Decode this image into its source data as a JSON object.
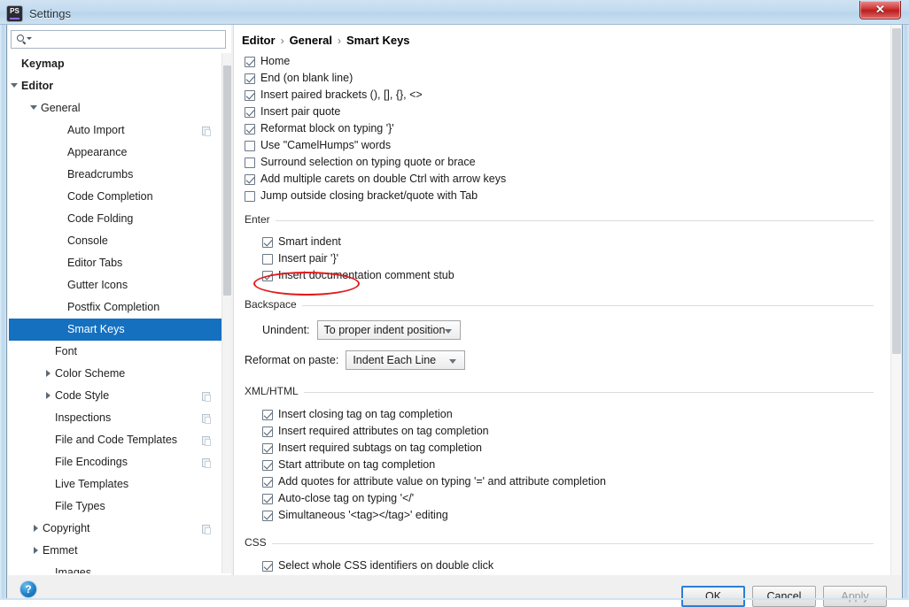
{
  "window": {
    "title": "Settings",
    "app_icon": "phpstorm-icon",
    "close_label": "✕",
    "ghost_text": "......... .... . ...... ...... .. ."
  },
  "search": {
    "value": "",
    "placeholder": "",
    "icon": "search-icon"
  },
  "sidebar": {
    "items": [
      {
        "label": "Keymap",
        "indent": 14,
        "bold": true,
        "arrow": "none",
        "copy": false,
        "selected": false
      },
      {
        "label": "Editor",
        "indent": 14,
        "bold": true,
        "arrow": "expanded",
        "copy": false,
        "selected": false
      },
      {
        "label": "General",
        "indent": 36,
        "bold": false,
        "arrow": "expanded",
        "copy": false,
        "selected": false
      },
      {
        "label": "Auto Import",
        "indent": 66,
        "bold": false,
        "arrow": "none",
        "copy": true,
        "selected": false
      },
      {
        "label": "Appearance",
        "indent": 66,
        "bold": false,
        "arrow": "none",
        "copy": false,
        "selected": false
      },
      {
        "label": "Breadcrumbs",
        "indent": 66,
        "bold": false,
        "arrow": "none",
        "copy": false,
        "selected": false
      },
      {
        "label": "Code Completion",
        "indent": 66,
        "bold": false,
        "arrow": "none",
        "copy": false,
        "selected": false
      },
      {
        "label": "Code Folding",
        "indent": 66,
        "bold": false,
        "arrow": "none",
        "copy": false,
        "selected": false
      },
      {
        "label": "Console",
        "indent": 66,
        "bold": false,
        "arrow": "none",
        "copy": false,
        "selected": false
      },
      {
        "label": "Editor Tabs",
        "indent": 66,
        "bold": false,
        "arrow": "none",
        "copy": false,
        "selected": false
      },
      {
        "label": "Gutter Icons",
        "indent": 66,
        "bold": false,
        "arrow": "none",
        "copy": false,
        "selected": false
      },
      {
        "label": "Postfix Completion",
        "indent": 66,
        "bold": false,
        "arrow": "none",
        "copy": false,
        "selected": false
      },
      {
        "label": "Smart Keys",
        "indent": 66,
        "bold": false,
        "arrow": "none",
        "copy": false,
        "selected": true
      },
      {
        "label": "Font",
        "indent": 52,
        "bold": false,
        "arrow": "none",
        "copy": false,
        "selected": false
      },
      {
        "label": "Color Scheme",
        "indent": 52,
        "bold": false,
        "arrow": "collapsed",
        "copy": false,
        "selected": false
      },
      {
        "label": "Code Style",
        "indent": 52,
        "bold": false,
        "arrow": "collapsed",
        "copy": true,
        "selected": false
      },
      {
        "label": "Inspections",
        "indent": 52,
        "bold": false,
        "arrow": "none",
        "copy": true,
        "selected": false
      },
      {
        "label": "File and Code Templates",
        "indent": 52,
        "bold": false,
        "arrow": "none",
        "copy": true,
        "selected": false
      },
      {
        "label": "File Encodings",
        "indent": 52,
        "bold": false,
        "arrow": "none",
        "copy": true,
        "selected": false
      },
      {
        "label": "Live Templates",
        "indent": 52,
        "bold": false,
        "arrow": "none",
        "copy": false,
        "selected": false
      },
      {
        "label": "File Types",
        "indent": 52,
        "bold": false,
        "arrow": "none",
        "copy": false,
        "selected": false
      },
      {
        "label": "Copyright",
        "indent": 38,
        "bold": false,
        "arrow": "collapsed",
        "copy": true,
        "selected": false
      },
      {
        "label": "Emmet",
        "indent": 38,
        "bold": false,
        "arrow": "collapsed",
        "copy": false,
        "selected": false
      },
      {
        "label": "Images",
        "indent": 52,
        "bold": false,
        "arrow": "none",
        "copy": false,
        "selected": false
      }
    ]
  },
  "breadcrumb": {
    "parts": [
      "Editor",
      "General",
      "Smart Keys"
    ],
    "separator": "›"
  },
  "main": {
    "top_options": [
      {
        "label": "Home",
        "checked": true
      },
      {
        "label": "End (on blank line)",
        "checked": true
      },
      {
        "label": "Insert paired brackets (), [], {}, <>",
        "checked": true
      },
      {
        "label": "Insert pair quote",
        "checked": true
      },
      {
        "label": "Reformat block on typing '}'",
        "checked": true
      },
      {
        "label": "Use \"CamelHumps\" words",
        "checked": false
      },
      {
        "label": "Surround selection on typing quote or brace",
        "checked": false
      },
      {
        "label": "Add multiple carets on double Ctrl with arrow keys",
        "checked": true
      },
      {
        "label": "Jump outside closing bracket/quote with Tab",
        "checked": false
      }
    ],
    "enter": {
      "title": "Enter",
      "options": [
        {
          "label": "Smart indent",
          "checked": true
        },
        {
          "label": "Insert pair '}'",
          "checked": false,
          "annotated": true
        },
        {
          "label": "Insert documentation comment stub",
          "checked": true
        }
      ]
    },
    "backspace": {
      "title": "Backspace",
      "unindent_label": "Unindent:",
      "unindent_value": "To proper indent position",
      "reformat_label": "Reformat on paste:",
      "reformat_value": "Indent Each Line"
    },
    "xmlhtml": {
      "title": "XML/HTML",
      "options": [
        {
          "label": "Insert closing tag on tag completion",
          "checked": true
        },
        {
          "label": "Insert required attributes on tag completion",
          "checked": true
        },
        {
          "label": "Insert required subtags on tag completion",
          "checked": true
        },
        {
          "label": "Start attribute on tag completion",
          "checked": true
        },
        {
          "label": "Add quotes for attribute value on typing '=' and attribute completion",
          "checked": true
        },
        {
          "label": "Auto-close tag on typing '</'",
          "checked": true
        },
        {
          "label": "Simultaneous '<tag></tag>' editing",
          "checked": true
        }
      ]
    },
    "css": {
      "title": "CSS",
      "options": [
        {
          "label": "Select whole CSS identifiers on double click",
          "checked": true
        }
      ]
    }
  },
  "footer": {
    "help_label": "?",
    "ok_label": "OK",
    "cancel_label": "Cancel",
    "apply_label": "Apply"
  },
  "colors": {
    "selection_blue": "#1570c0",
    "annotation_red": "#e01b1b",
    "titlebar_blue": "#c3dbef",
    "close_red": "#ba1f1f"
  }
}
